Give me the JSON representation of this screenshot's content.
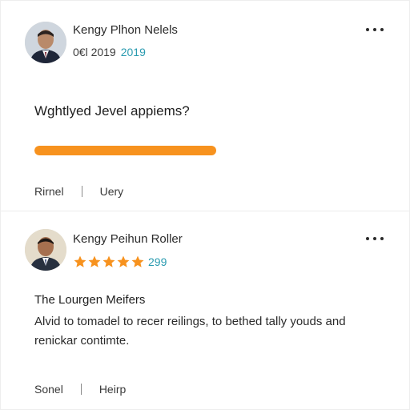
{
  "colors": {
    "accent_orange": "#f7921e",
    "accent_teal": "#2a9bb0",
    "text_dark": "#2b2b2b"
  },
  "post": {
    "author": "Kengy Plhon Nelels",
    "date": "0€l 2019",
    "year": "2019",
    "menu_icon": "more-horizontal-icon",
    "question": "Wghtlyed Jevel appiems?",
    "progress": 0.63,
    "actions": {
      "left": "Rirnel",
      "right": "Uery"
    }
  },
  "review": {
    "author": "Kengy Peihun Roller",
    "menu_icon": "more-horizontal-icon",
    "stars": 5,
    "rating_count": "299",
    "title": "The Lourgen Meifers",
    "body": "Alvid to tomadel to recer reilings, to bethed tally youds and renickar contimte.",
    "actions": {
      "left": "Sonel",
      "right": "Heirp"
    }
  }
}
